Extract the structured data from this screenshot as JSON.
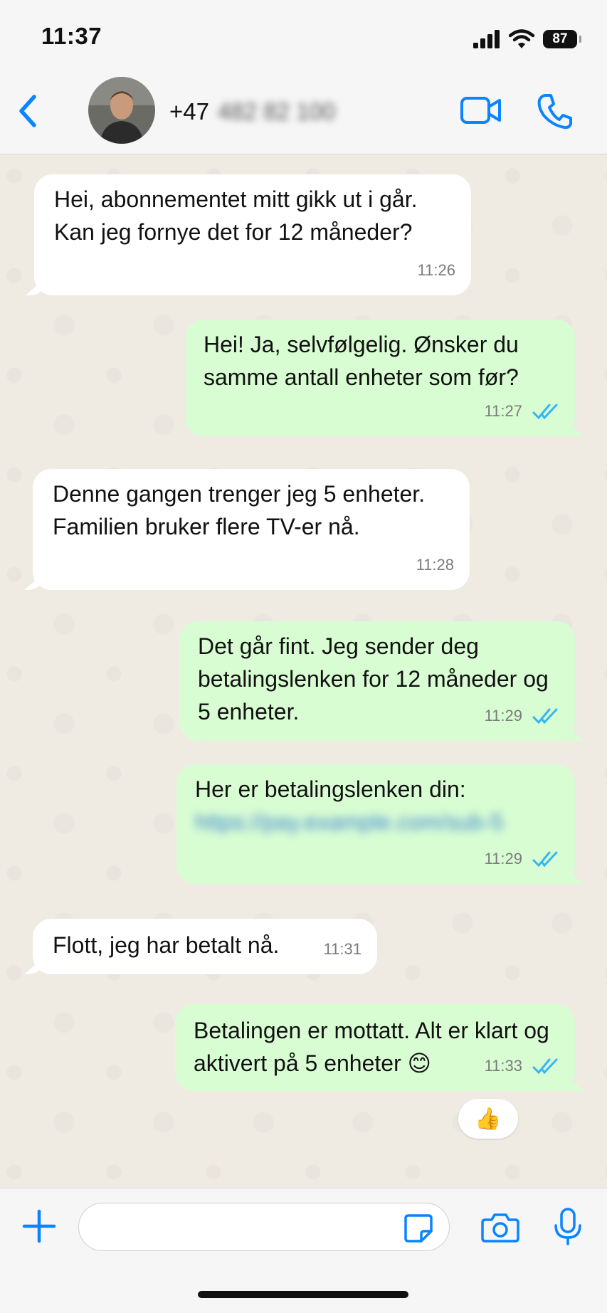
{
  "status_bar": {
    "time": "11:37",
    "battery": "87"
  },
  "header": {
    "country_code": "+47",
    "number_hidden": "482 82 100"
  },
  "messages": [
    {
      "direction": "in",
      "text": "Hei, abonnementet mitt gikk ut i går. Kan jeg fornye det for 12 måneder?",
      "time": "11:26"
    },
    {
      "direction": "out",
      "text": "Hei! Ja, selvfølgelig. Ønsker du samme antall enheter som før?",
      "time": "11:27",
      "read": true
    },
    {
      "direction": "in",
      "text": "Denne gangen trenger jeg 5 enheter. Familien bruker flere TV-er nå.",
      "time": "11:28"
    },
    {
      "direction": "out",
      "text": "Det går fint. Jeg sender deg betalingslenken for 12 måneder og 5 enheter.",
      "time": "11:29",
      "read": true
    },
    {
      "direction": "out",
      "text": "Her er betalingslenken din:",
      "link": "https://pay.example.com/sub-5",
      "time": "11:29",
      "read": true
    },
    {
      "direction": "in",
      "text": "Flott, jeg har betalt nå.",
      "time": "11:31"
    },
    {
      "direction": "out",
      "text": "Betalingen er mottatt. Alt er klart og aktivert på 5 enheter 😊",
      "time": "11:33",
      "read": true
    }
  ],
  "reaction": "👍",
  "input": {
    "placeholder": ""
  },
  "colors": {
    "accent": "#0a84ff",
    "outgoing_bubble": "#d9fdd3",
    "incoming_bubble": "#ffffff",
    "read_ticks": "#34b7f1"
  }
}
